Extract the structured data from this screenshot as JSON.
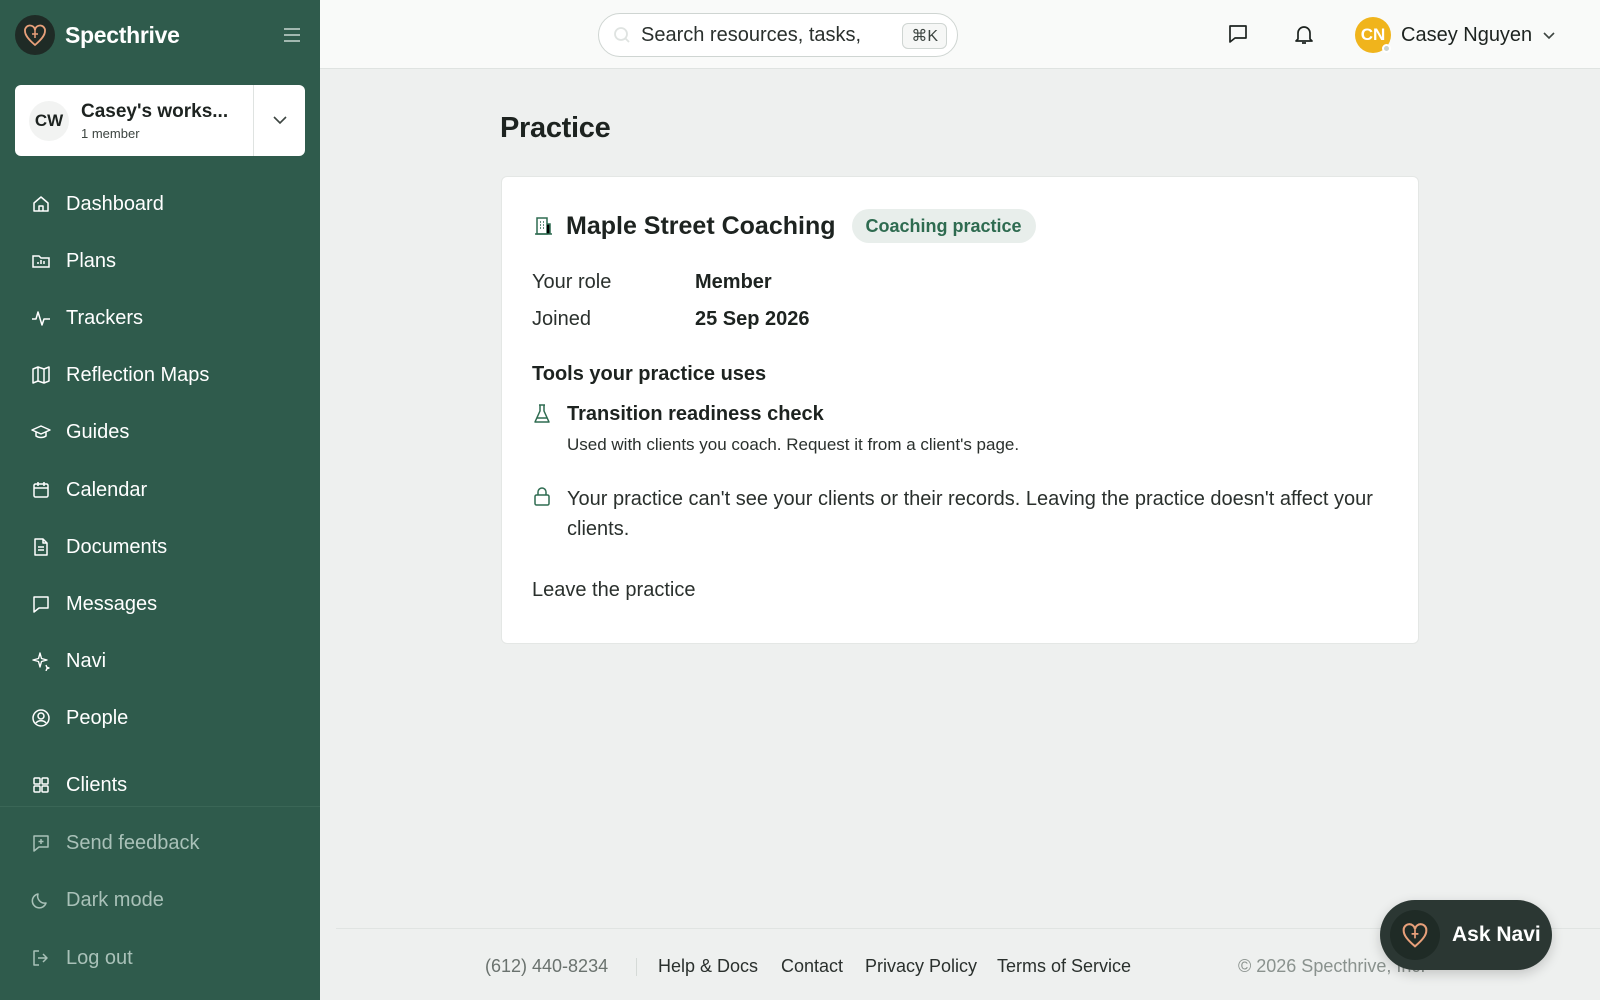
{
  "brand": {
    "name": "Specthrive"
  },
  "workspace": {
    "initials": "CW",
    "name": "Casey's works...",
    "members": "1 member"
  },
  "sidebar": {
    "items": [
      {
        "label": "Dashboard",
        "icon": "home-icon"
      },
      {
        "label": "Plans",
        "icon": "folder-chart-icon"
      },
      {
        "label": "Trackers",
        "icon": "activity-icon"
      },
      {
        "label": "Reflection Maps",
        "icon": "map-icon"
      },
      {
        "label": "Guides",
        "icon": "graduation-cap-icon"
      },
      {
        "label": "Calendar",
        "icon": "calendar-icon"
      },
      {
        "label": "Documents",
        "icon": "document-icon"
      },
      {
        "label": "Messages",
        "icon": "message-icon"
      },
      {
        "label": "Navi",
        "icon": "sparkle-icon"
      },
      {
        "label": "People",
        "icon": "user-circle-icon"
      },
      {
        "label": "Clients",
        "icon": "grid-icon"
      }
    ],
    "footer_items": [
      {
        "label": "Send feedback",
        "icon": "feedback-icon"
      },
      {
        "label": "Dark mode",
        "icon": "moon-icon"
      },
      {
        "label": "Log out",
        "icon": "logout-icon"
      }
    ]
  },
  "topbar": {
    "search_placeholder": "Search resources, tasks,",
    "search_shortcut": "⌘K",
    "user": {
      "initials": "CN",
      "name": "Casey Nguyen"
    }
  },
  "main": {
    "title": "Practice",
    "card": {
      "practice_name": "Maple Street Coaching",
      "badge": "Coaching practice",
      "role_label": "Your role",
      "role_value": "Member",
      "joined_label": "Joined",
      "joined_value": "25 Sep 2026",
      "tools_heading": "Tools your practice uses",
      "tool_name": "Transition readiness check",
      "tool_desc": "Used with clients you coach. Request it from a client's page.",
      "privacy_note": "Your practice can't see your clients or their records. Leaving the practice doesn't affect your clients.",
      "leave_label": "Leave the practice"
    }
  },
  "footer": {
    "phone": "(612) 440-8234",
    "links": [
      "Help & Docs",
      "Contact",
      "Privacy Policy",
      "Terms of Service"
    ],
    "copyright": "© 2026 Specthrive, Inc."
  },
  "ask_navi": {
    "label": "Ask Navi"
  },
  "colors": {
    "sidebar": "#2f5b4c",
    "accent": "#2e6b50",
    "avatar": "#f0b41c"
  }
}
